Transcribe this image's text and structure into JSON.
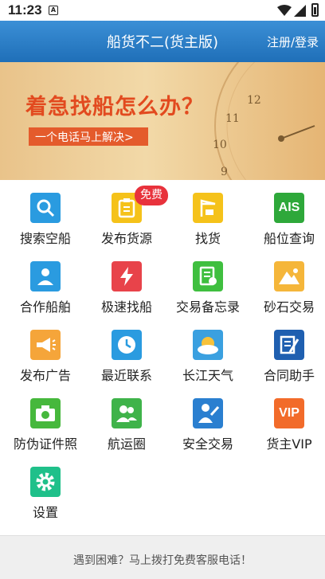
{
  "status_bar": {
    "time": "11:23",
    "notification_letter": "A"
  },
  "app_bar": {
    "title": "船货不二(货主版)",
    "login": "注册/登录"
  },
  "banner": {
    "headline": "着急找船怎么办？",
    "subline": "一个电话马上解决>",
    "clock_numbers": [
      "12",
      "11",
      "10",
      "9"
    ]
  },
  "grid": {
    "items": [
      {
        "label": "搜索空船",
        "icon": "search-icon",
        "color": "#2a9be0"
      },
      {
        "label": "发布货源",
        "icon": "clipboard-icon",
        "color": "#f5c21a",
        "badge": "免费"
      },
      {
        "label": "找货",
        "icon": "crane-icon",
        "color": "#f5c21a"
      },
      {
        "label": "船位查询",
        "icon": "ais-icon",
        "color": "#2ea83a",
        "icon_text": "AIS"
      },
      {
        "label": "合作船舶",
        "icon": "person-ship-icon",
        "color": "#2a9be0"
      },
      {
        "label": "极速找船",
        "icon": "lightning-icon",
        "color": "#e8434a"
      },
      {
        "label": "交易备忘录",
        "icon": "memo-icon",
        "color": "#3fbf3f"
      },
      {
        "label": "砂石交易",
        "icon": "mountain-icon",
        "color": "#f5b63a"
      },
      {
        "label": "发布广告",
        "icon": "megaphone-icon",
        "color": "#f5a53a"
      },
      {
        "label": "最近联系",
        "icon": "clock-icon",
        "color": "#2a9be0"
      },
      {
        "label": "长江天气",
        "icon": "weather-icon",
        "color": "#3aa0e0"
      },
      {
        "label": "合同助手",
        "icon": "contract-icon",
        "color": "#1f5fb0"
      },
      {
        "label": "防伪证件照",
        "icon": "camera-icon",
        "color": "#46b83c"
      },
      {
        "label": "航运圈",
        "icon": "people-icon",
        "color": "#3fb34a"
      },
      {
        "label": "安全交易",
        "icon": "shield-person-icon",
        "color": "#2a7fd0"
      },
      {
        "label": "货主VIP",
        "icon": "vip-icon",
        "color": "#f26b2a",
        "icon_text": "VIP"
      },
      {
        "label": "设置",
        "icon": "gear-icon",
        "color": "#1fc08a"
      }
    ]
  },
  "footer": {
    "text": "遇到困难？马上拨打免费客服电话！"
  }
}
